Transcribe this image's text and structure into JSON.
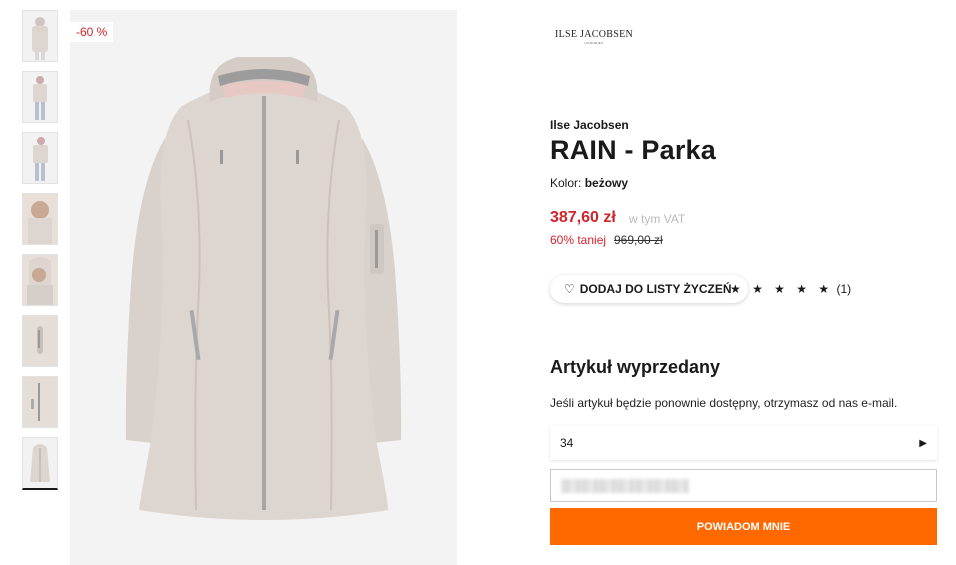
{
  "gallery": {
    "thumbnails": [
      "thumbnail-1",
      "thumbnail-2",
      "thumbnail-3",
      "thumbnail-4",
      "thumbnail-5",
      "thumbnail-6",
      "thumbnail-7",
      "thumbnail-8"
    ],
    "active_index": 8,
    "discount_badge": "-60 %",
    "main_image": "parka-coat-image"
  },
  "brand_logo": {
    "line1": "ILSE JACOBSEN",
    "line2": "HORNBÆK"
  },
  "product": {
    "brand": "Ilse Jacobsen",
    "title": "RAIN - Parka",
    "color_label": "Kolor:",
    "color_value": "beżowy",
    "price": "387,60 zł",
    "vat_note": "w tym VAT",
    "discount_text": "60% taniej",
    "old_price": "969,00 zł",
    "wishlist_label": "DODAJ DO LISTY ŻYCZEŃ",
    "rating_stars": "★ ★ ★ ★ ★",
    "rating_count": "(1)"
  },
  "soldout": {
    "heading": "Artykuł wyprzedany",
    "notify_text": "Jeśli artykuł będzie ponownie dostępny, otrzymasz od nas e-mail.",
    "size_value": "34",
    "email_placeholder": "",
    "notify_button": "POWIADOM MNIE"
  },
  "colors": {
    "accent": "#ff6900",
    "sale": "#d0242b",
    "coat": "#ddd5cf"
  }
}
